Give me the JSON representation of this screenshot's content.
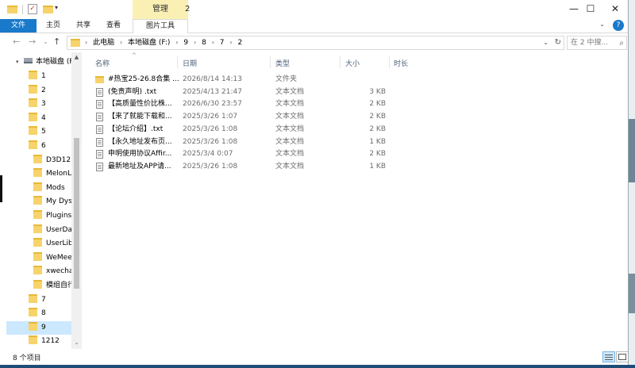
{
  "titlebar": {
    "manage_label": "管理",
    "title": "2",
    "minimize": "—",
    "maximize": "☐",
    "close": "✕",
    "qa_arrow": "▾"
  },
  "ribbon": {
    "tabs": [
      "文件",
      "主页",
      "共享",
      "查看",
      "图片工具"
    ],
    "collapse": "⌄",
    "help": "?"
  },
  "nav_buttons": {
    "back": "←",
    "forward": "→",
    "recent": "⌄",
    "up": "↑"
  },
  "address": {
    "crumbs": [
      "此电脑",
      "本地磁盘 (F:)",
      "9",
      "8",
      "7",
      "2"
    ],
    "sep": "›",
    "dropdown": "⌄",
    "refresh": "↻"
  },
  "search": {
    "placeholder": "在 2 中搜...",
    "icon": "search-icon"
  },
  "navpane": {
    "drive": "本地磁盘 (F",
    "items": [
      {
        "label": "1",
        "indent": 1
      },
      {
        "label": "2",
        "indent": 1
      },
      {
        "label": "3",
        "indent": 1
      },
      {
        "label": "4",
        "indent": 1
      },
      {
        "label": "5",
        "indent": 1
      },
      {
        "label": "6",
        "indent": 1
      },
      {
        "label": "D3D12",
        "indent": 2
      },
      {
        "label": "MelonLo",
        "indent": 2
      },
      {
        "label": "Mods",
        "indent": 2
      },
      {
        "label": "My Dyst",
        "indent": 2
      },
      {
        "label": "Plugins",
        "indent": 2
      },
      {
        "label": "UserDat",
        "indent": 2
      },
      {
        "label": "UserLibs",
        "indent": 2
      },
      {
        "label": "WeMeet",
        "indent": 2
      },
      {
        "label": "xwechat",
        "indent": 2
      },
      {
        "label": "模组自行",
        "indent": 2
      },
      {
        "label": "7",
        "indent": 1
      },
      {
        "label": "8",
        "indent": 1
      },
      {
        "label": "9",
        "indent": 1,
        "selected": true
      },
      {
        "label": "1212",
        "indent": 1
      }
    ],
    "scroll_up": "▲",
    "scroll_down": "⌄"
  },
  "columns": {
    "name": "名称",
    "date": "日期",
    "type": "类型",
    "size": "大小",
    "duration": "时长",
    "sort_arrow": "^"
  },
  "files": [
    {
      "name": "#热宝25-26.8合集 ...",
      "date": "2026/8/14 14:13",
      "type": "文件夹",
      "size": "",
      "kind": "folder"
    },
    {
      "name": "(免责声明) .txt",
      "date": "2025/4/13 21:47",
      "type": "文本文档",
      "size": "3 KB",
      "kind": "doc"
    },
    {
      "name": "【高质量性价比株...",
      "date": "2026/6/30 23:57",
      "type": "文本文档",
      "size": "2 KB",
      "kind": "doc"
    },
    {
      "name": "【来了就能下载和...",
      "date": "2025/3/26 1:07",
      "type": "文本文档",
      "size": "2 KB",
      "kind": "doc"
    },
    {
      "name": "【论坛介绍】.txt",
      "date": "2025/3/26 1:08",
      "type": "文本文档",
      "size": "2 KB",
      "kind": "doc"
    },
    {
      "name": "【永久地址发布页...",
      "date": "2025/3/26 1:08",
      "type": "文本文档",
      "size": "1 KB",
      "kind": "doc"
    },
    {
      "name": "申明使用协议Affir...",
      "date": "2025/3/4 0:07",
      "type": "文本文档",
      "size": "2 KB",
      "kind": "doc"
    },
    {
      "name": "最新地址及APP请...",
      "date": "2025/3/26 1:08",
      "type": "文本文档",
      "size": "1 KB",
      "kind": "doc"
    }
  ],
  "status": {
    "count": "8 个项目"
  }
}
